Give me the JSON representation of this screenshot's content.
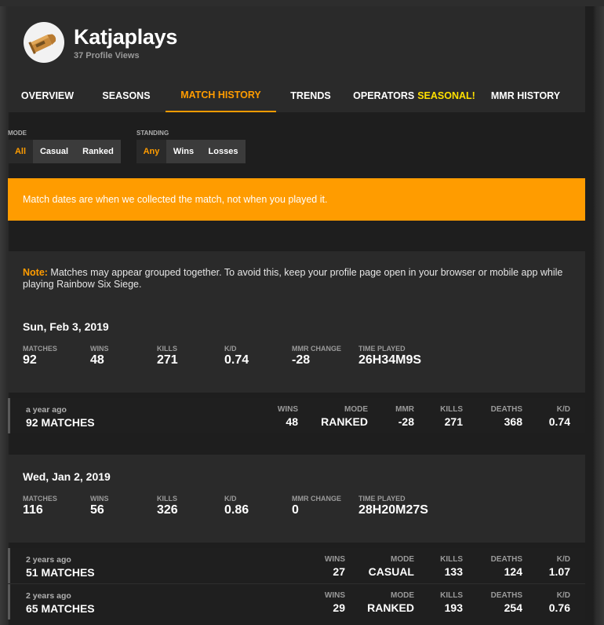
{
  "profile": {
    "name": "Katjaplays",
    "views": "37 Profile Views"
  },
  "nav": {
    "tabs": [
      {
        "label": "OVERVIEW"
      },
      {
        "label": "SEASONS"
      },
      {
        "label": "MATCH HISTORY"
      },
      {
        "label": "TRENDS"
      },
      {
        "label": "OPERATORS",
        "badge": "SEASONAL!"
      },
      {
        "label": "MMR HISTORY"
      }
    ],
    "active": "MATCH HISTORY"
  },
  "filters": {
    "mode": {
      "label": "MODE",
      "options": [
        "All",
        "Casual",
        "Ranked"
      ],
      "selected": "All"
    },
    "standing": {
      "label": "STANDING",
      "options": [
        "Any",
        "Wins",
        "Losses"
      ],
      "selected": "Any"
    }
  },
  "notice": "Match dates are when we collected the match, not when you played it.",
  "note": {
    "label": "Note:",
    "text": " Matches may appear grouped together. To avoid this, keep your profile page open in your browser or mobile app while playing Rainbow Six Siege."
  },
  "stat_labels": {
    "matches": "MATCHES",
    "wins": "WINS",
    "kills": "KILLS",
    "kd": "K/D",
    "mmr_change": "MMR CHANGE",
    "time_played": "TIME PLAYED"
  },
  "row_labels": {
    "wins": "WINS",
    "mode": "MODE",
    "mmr": "MMR",
    "kills": "KILLS",
    "deaths": "DEATHS",
    "kd": "K/D"
  },
  "days": [
    {
      "date": "Sun, Feb 3, 2019",
      "matches": "92",
      "wins": "48",
      "kills": "271",
      "kd": "0.74",
      "mmr_change": "-28",
      "time_played": "26H34M9S",
      "sessions": [
        {
          "when": "a year ago",
          "count": "92 MATCHES",
          "wins": "48",
          "mode": "RANKED",
          "mmr": "-28",
          "kills": "271",
          "deaths": "368",
          "kd": "0.74"
        }
      ]
    },
    {
      "date": "Wed, Jan 2, 2019",
      "matches": "116",
      "wins": "56",
      "kills": "326",
      "kd": "0.86",
      "mmr_change": "0",
      "time_played": "28H20M27S",
      "sessions": [
        {
          "when": "2 years ago",
          "count": "51 MATCHES",
          "wins": "27",
          "mode": "CASUAL",
          "kills": "133",
          "deaths": "124",
          "kd": "1.07"
        },
        {
          "when": "2 years ago",
          "count": "65 MATCHES",
          "wins": "29",
          "mode": "RANKED",
          "kills": "193",
          "deaths": "254",
          "kd": "0.76"
        }
      ]
    }
  ],
  "colors": {
    "accent": "#ff9c00",
    "seasonal": "#ffe000",
    "card": "#2a2a2a",
    "background": "#1e1e1e"
  }
}
